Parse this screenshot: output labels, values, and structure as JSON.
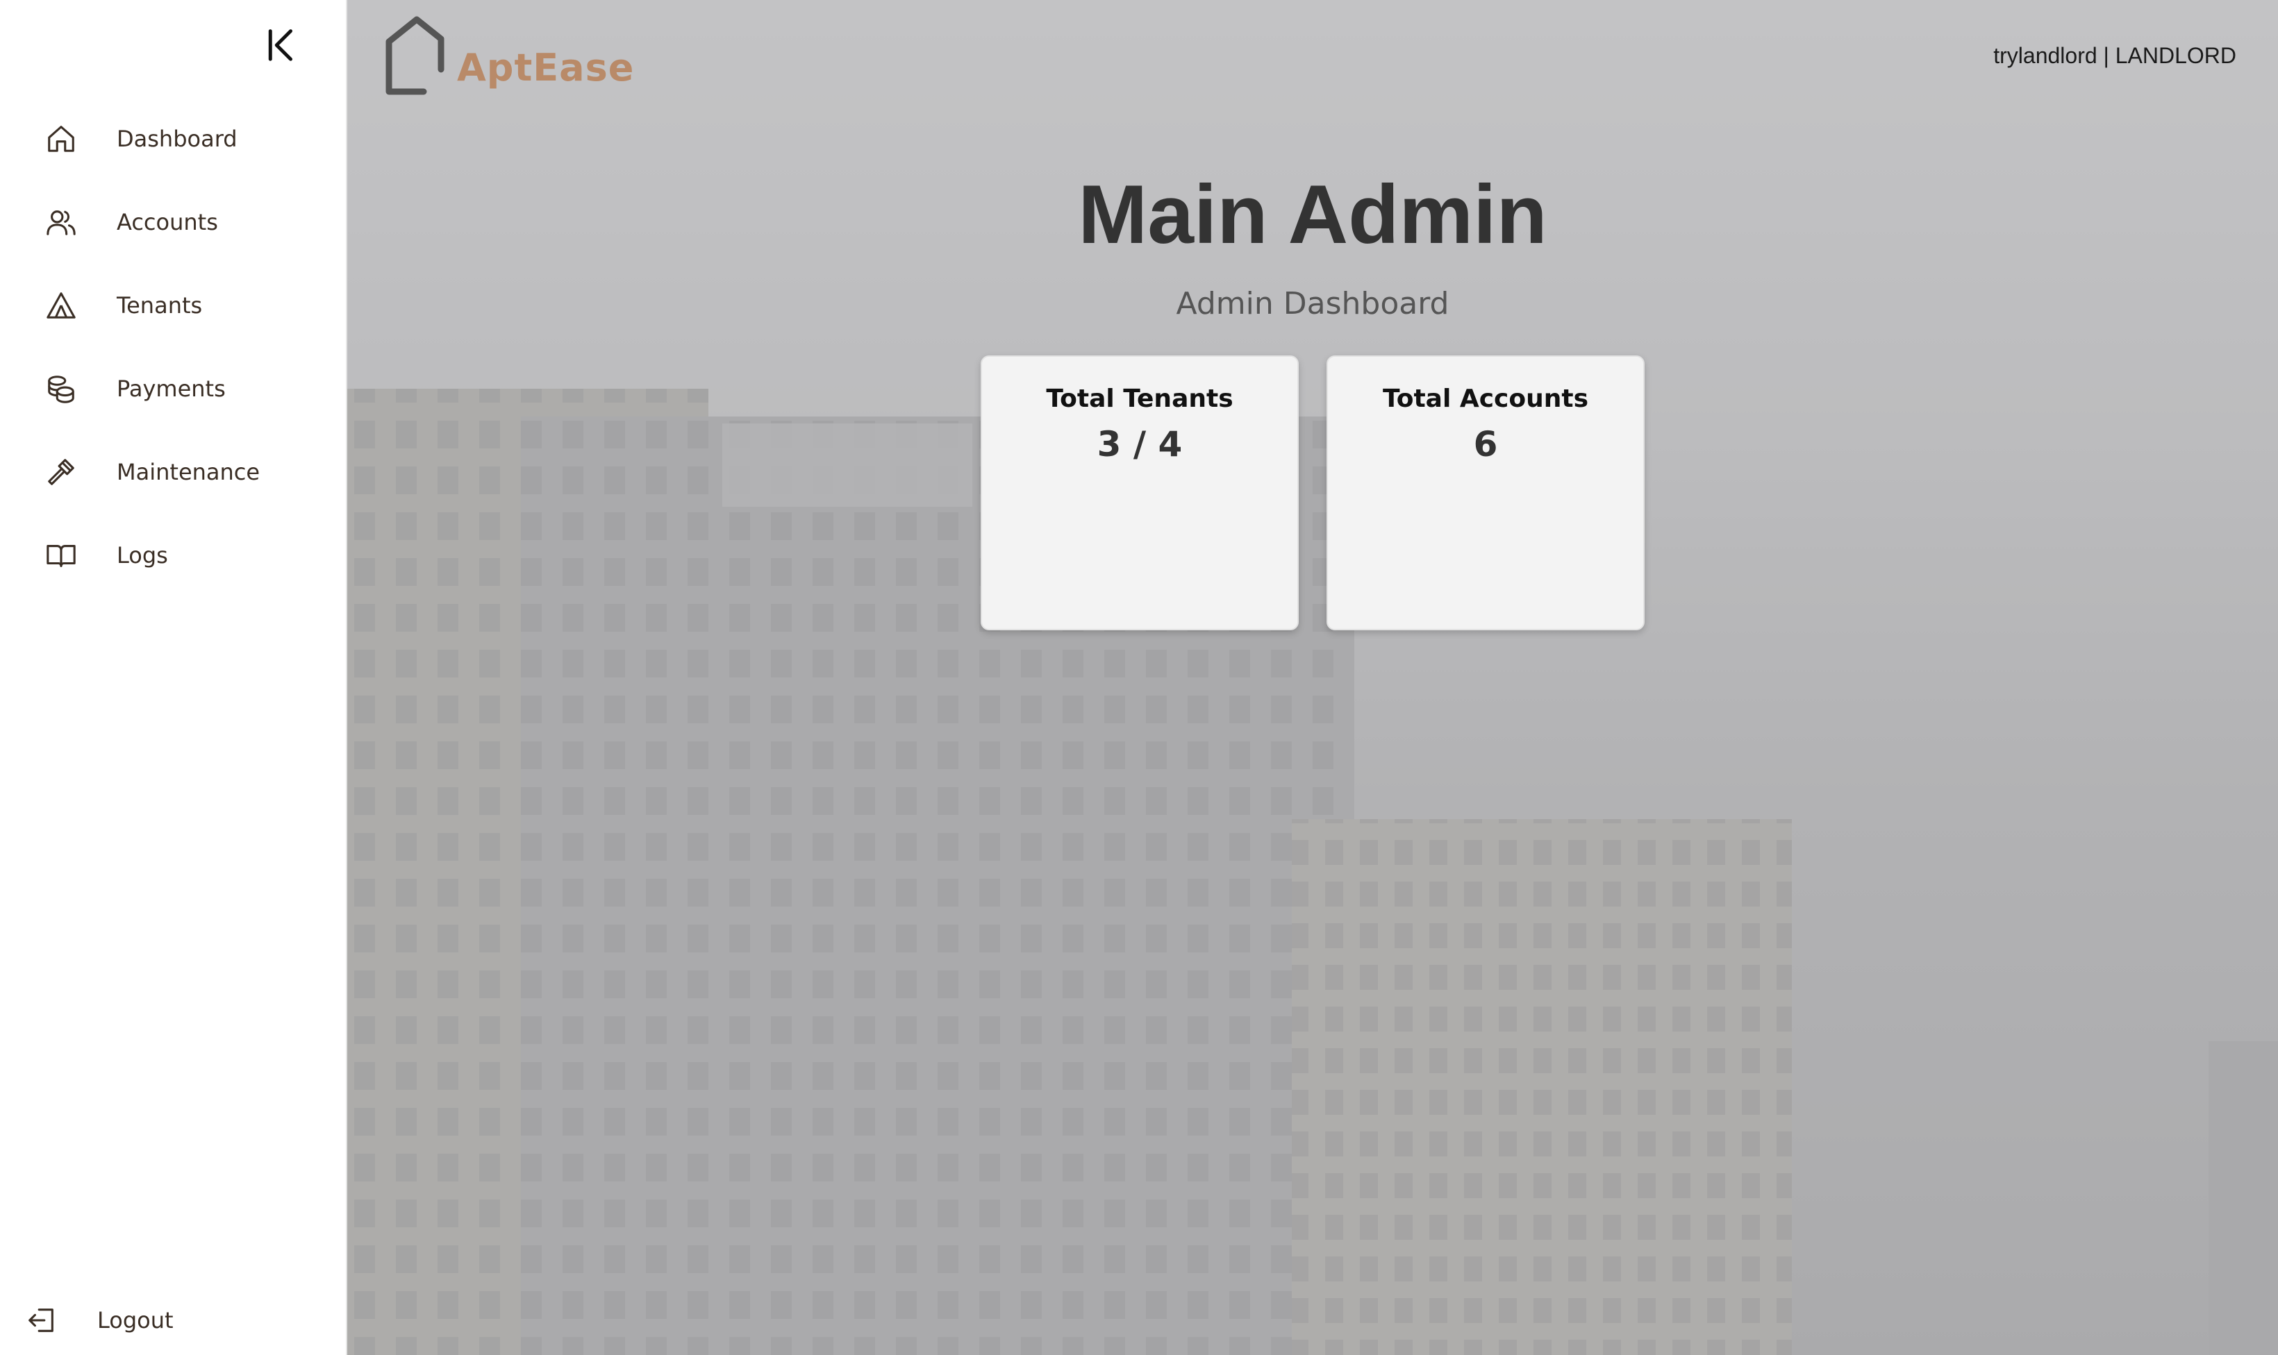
{
  "app": {
    "name": "AptEase"
  },
  "sidebar": {
    "items": [
      {
        "label": "Dashboard",
        "icon": "home-icon"
      },
      {
        "label": "Accounts",
        "icon": "users-icon"
      },
      {
        "label": "Tenants",
        "icon": "tent-icon"
      },
      {
        "label": "Payments",
        "icon": "coins-icon"
      },
      {
        "label": "Maintenance",
        "icon": "hammer-icon"
      },
      {
        "label": "Logs",
        "icon": "book-icon"
      }
    ],
    "logout_label": "Logout"
  },
  "header": {
    "user_info": "trylandlord | LANDLORD"
  },
  "main": {
    "title": "Main Admin",
    "subtitle": "Admin Dashboard",
    "cards": [
      {
        "title": "Total Tenants",
        "value": "3 / 4"
      },
      {
        "title": "Total Accounts",
        "value": "6"
      }
    ]
  },
  "colors": {
    "brand": "#b98a68",
    "sidebar_text": "#3a2e25",
    "card_bg": "#f3f3f3"
  }
}
